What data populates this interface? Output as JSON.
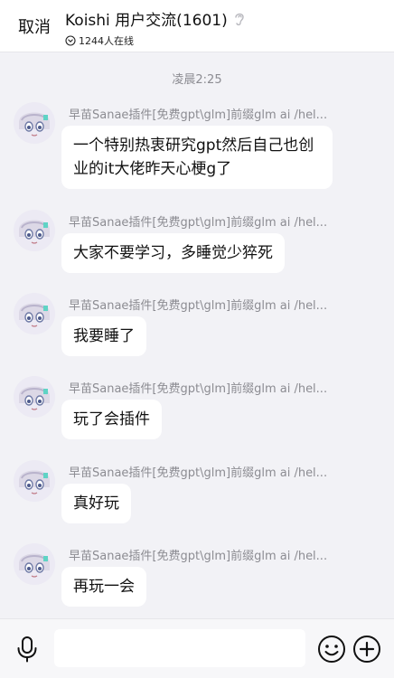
{
  "header": {
    "cancel_label": "取消",
    "title": "Koishi 用户交流(1601)",
    "online_text": "1244人在线"
  },
  "chat": {
    "time_separator": "凌晨2:25",
    "messages": [
      {
        "sender": "早苗Sanae插件[免费gpt\\glm]前缀glm ai /hel...",
        "text": "一个特别热衷研究gpt然后自己也创业的it大佬昨天心梗g了"
      },
      {
        "sender": "早苗Sanae插件[免费gpt\\glm]前缀glm ai /hel...",
        "text": "大家不要学习，多睡觉少猝死"
      },
      {
        "sender": "早苗Sanae插件[免费gpt\\glm]前缀glm ai /hel...",
        "text": "我要睡了"
      },
      {
        "sender": "早苗Sanae插件[免费gpt\\glm]前缀glm ai /hel...",
        "text": "玩了会插件"
      },
      {
        "sender": "早苗Sanae插件[免费gpt\\glm]前缀glm ai /hel...",
        "text": "真好玩"
      },
      {
        "sender": "早苗Sanae插件[免费gpt\\glm]前缀glm ai /hel...",
        "text": "再玩一会"
      }
    ]
  },
  "input": {
    "value": "",
    "placeholder": ""
  },
  "icons": {
    "mic": "microphone-icon",
    "emoji": "emoji-icon",
    "plus": "plus-icon",
    "ear": "ear-icon",
    "online": "chevron-down-circle-icon"
  }
}
